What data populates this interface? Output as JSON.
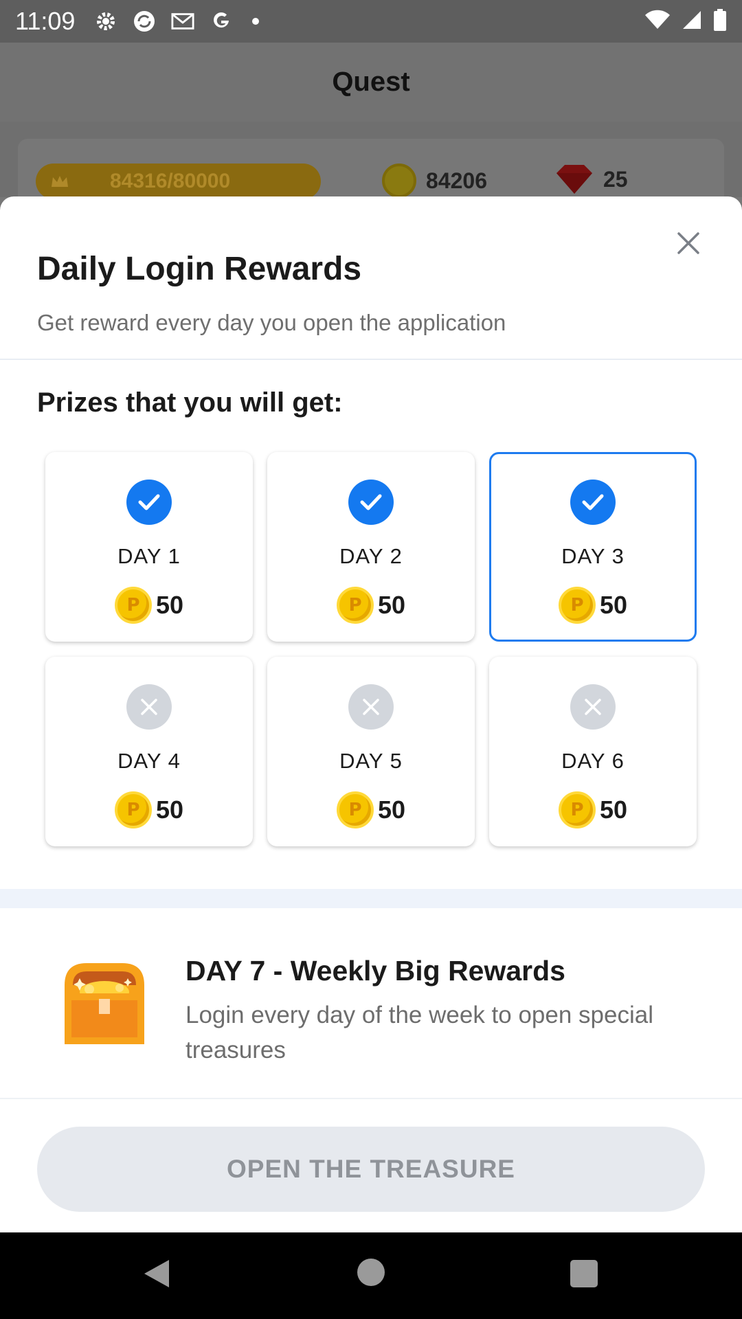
{
  "status_bar": {
    "time": "11:09",
    "icons": [
      "gear-icon",
      "sync-icon",
      "mail-icon",
      "google-icon",
      "dot-icon",
      "wifi-icon",
      "signal-icon",
      "battery-icon"
    ]
  },
  "app": {
    "title": "Quest",
    "progress_text": "84316/80000",
    "coins": "84206",
    "gems": "25"
  },
  "dialog": {
    "title": "Daily Login Rewards",
    "subtitle": "Get reward every day you open the application",
    "prizes_title": "Prizes that you will get:",
    "days": [
      {
        "label": "DAY 1",
        "amount": "50",
        "claimed": true
      },
      {
        "label": "DAY 2",
        "amount": "50",
        "claimed": true
      },
      {
        "label": "DAY 3",
        "amount": "50",
        "claimed": true,
        "current": true
      },
      {
        "label": "DAY 4",
        "amount": "50",
        "claimed": false
      },
      {
        "label": "DAY 5",
        "amount": "50",
        "claimed": false
      },
      {
        "label": "DAY 6",
        "amount": "50",
        "claimed": false
      }
    ],
    "coin_letter": "P",
    "weekly": {
      "title": "DAY 7 - Weekly Big Rewards",
      "description": "Login every day of the week to open special treasures"
    },
    "button_label": "OPEN THE TREASURE"
  },
  "colors": {
    "accent": "#1479f0",
    "coin": "#f6c400",
    "disabled_button": "#e6e9ee"
  }
}
